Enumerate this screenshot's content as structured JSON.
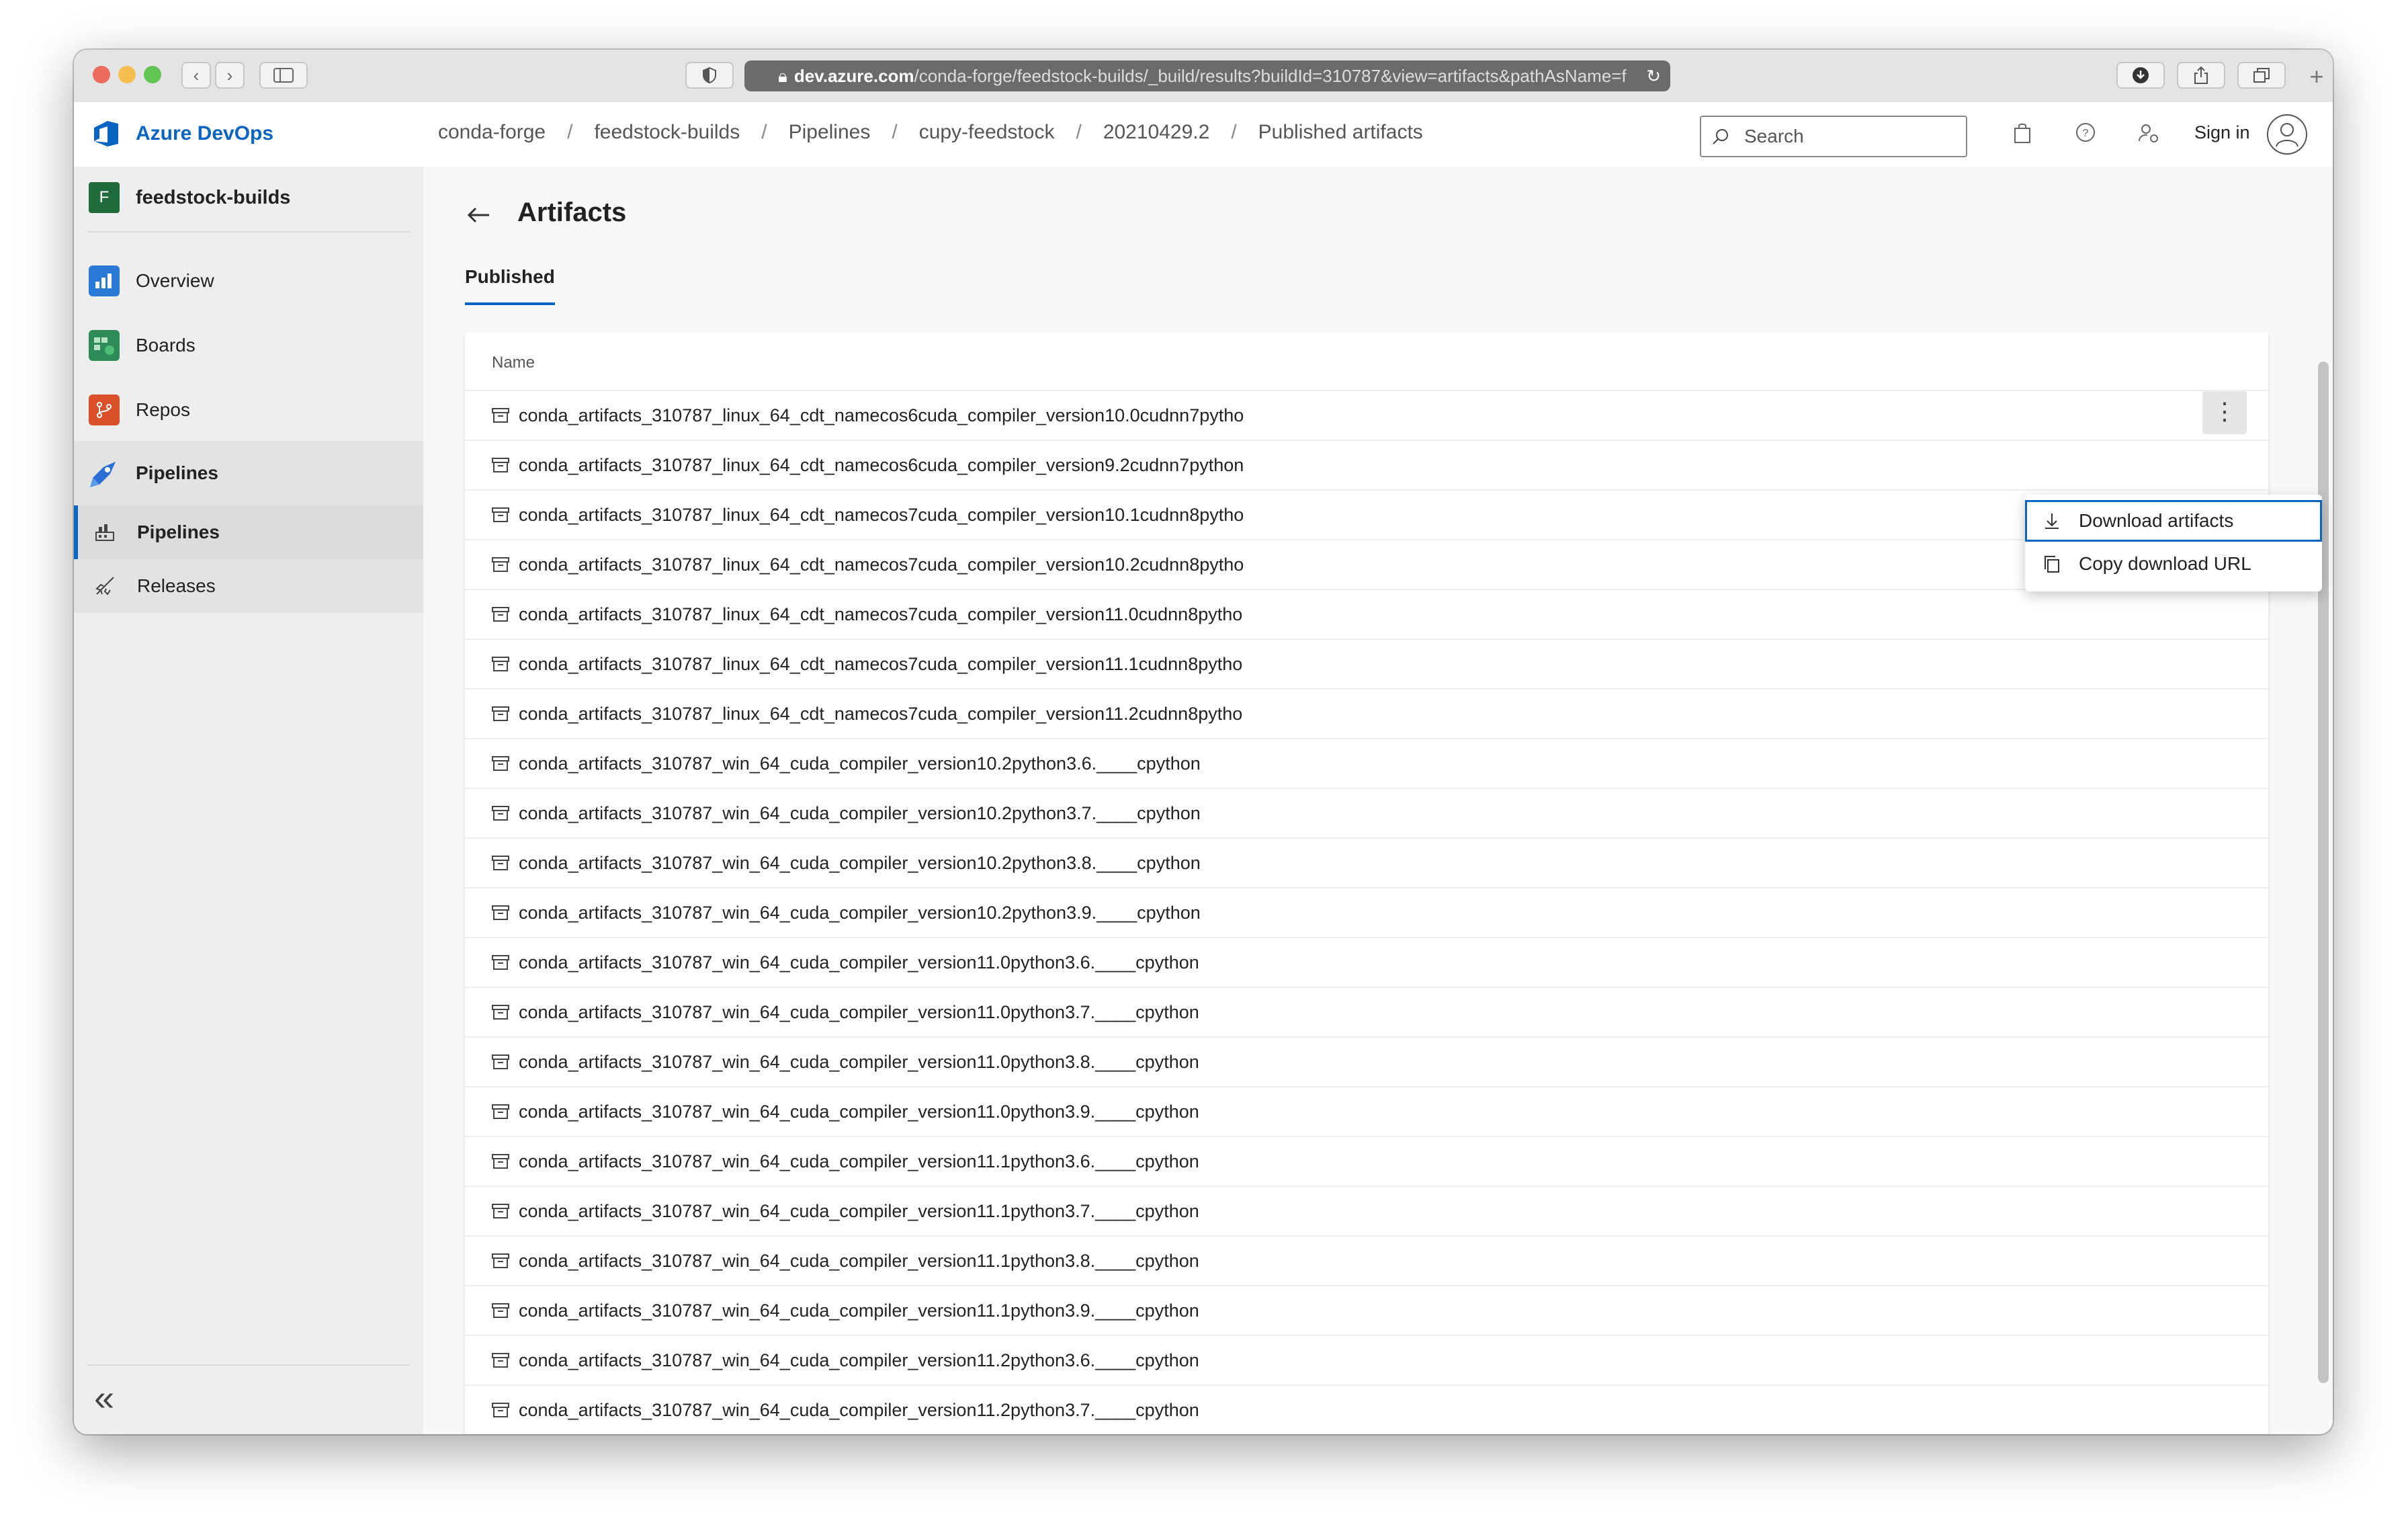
{
  "browser": {
    "url_domain": "dev.azure.com",
    "url_path": "/conda-forge/feedstock-builds/_build/results?buildId=310787&view=artifacts&pathAsName=f"
  },
  "header": {
    "brand": "Azure DevOps",
    "breadcrumbs": [
      "conda-forge",
      "feedstock-builds",
      "Pipelines",
      "cupy-feedstock",
      "20210429.2",
      "Published artifacts"
    ],
    "search_placeholder": "Search",
    "sign_in": "Sign in"
  },
  "sidebar": {
    "project_initial": "F",
    "project_name": "feedstock-builds",
    "items": [
      {
        "label": "Overview"
      },
      {
        "label": "Boards"
      },
      {
        "label": "Repos"
      },
      {
        "label": "Pipelines"
      },
      {
        "label": "Pipelines"
      },
      {
        "label": "Releases"
      }
    ],
    "collapse_glyph": "«"
  },
  "main": {
    "title": "Artifacts",
    "tab": "Published",
    "column_header": "Name",
    "rows": [
      "conda_artifacts_310787_linux_64_cdt_namecos6cuda_compiler_version10.0cudnn7pytho",
      "conda_artifacts_310787_linux_64_cdt_namecos6cuda_compiler_version9.2cudnn7python",
      "conda_artifacts_310787_linux_64_cdt_namecos7cuda_compiler_version10.1cudnn8pytho",
      "conda_artifacts_310787_linux_64_cdt_namecos7cuda_compiler_version10.2cudnn8pytho",
      "conda_artifacts_310787_linux_64_cdt_namecos7cuda_compiler_version11.0cudnn8pytho",
      "conda_artifacts_310787_linux_64_cdt_namecos7cuda_compiler_version11.1cudnn8pytho",
      "conda_artifacts_310787_linux_64_cdt_namecos7cuda_compiler_version11.2cudnn8pytho",
      "conda_artifacts_310787_win_64_cuda_compiler_version10.2python3.6.____cpython",
      "conda_artifacts_310787_win_64_cuda_compiler_version10.2python3.7.____cpython",
      "conda_artifacts_310787_win_64_cuda_compiler_version10.2python3.8.____cpython",
      "conda_artifacts_310787_win_64_cuda_compiler_version10.2python3.9.____cpython",
      "conda_artifacts_310787_win_64_cuda_compiler_version11.0python3.6.____cpython",
      "conda_artifacts_310787_win_64_cuda_compiler_version11.0python3.7.____cpython",
      "conda_artifacts_310787_win_64_cuda_compiler_version11.0python3.8.____cpython",
      "conda_artifacts_310787_win_64_cuda_compiler_version11.0python3.9.____cpython",
      "conda_artifacts_310787_win_64_cuda_compiler_version11.1python3.6.____cpython",
      "conda_artifacts_310787_win_64_cuda_compiler_version11.1python3.7.____cpython",
      "conda_artifacts_310787_win_64_cuda_compiler_version11.1python3.8.____cpython",
      "conda_artifacts_310787_win_64_cuda_compiler_version11.1python3.9.____cpython",
      "conda_artifacts_310787_win_64_cuda_compiler_version11.2python3.6.____cpython",
      "conda_artifacts_310787_win_64_cuda_compiler_version11.2python3.7.____cpython"
    ]
  },
  "context_menu": {
    "download": "Download artifacts",
    "copy_url": "Copy download URL"
  },
  "colors": {
    "accent": "#0a65c2",
    "project": "#1f6b3b"
  }
}
